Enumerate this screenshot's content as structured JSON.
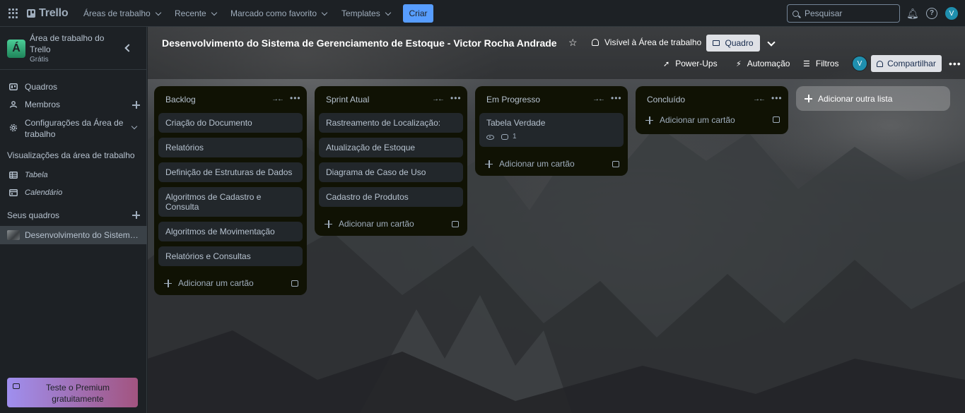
{
  "topnav": {
    "app_name": "Trello",
    "menus": [
      "Áreas de trabalho",
      "Recente",
      "Marcado como favorito",
      "Templates"
    ],
    "create_label": "Criar",
    "search_placeholder": "Pesquisar",
    "avatar_initial": "V",
    "icons": [
      "app-switcher-icon",
      "trello-logo-icon",
      "search-icon",
      "notifications-icon",
      "help-icon"
    ]
  },
  "sidebar": {
    "workspace_initial": "Á",
    "workspace_name": "Área de trabalho do Trello",
    "workspace_plan": "Grátis",
    "items": [
      {
        "label": "Quadros",
        "icon": "board-icon"
      },
      {
        "label": "Membros",
        "icon": "members-icon"
      },
      {
        "label": "Configurações da Área de trabalho",
        "icon": "gear-icon"
      }
    ],
    "views_heading": "Visualizações da área de trabalho",
    "views": [
      {
        "label": "Tabela",
        "icon": "table-icon"
      },
      {
        "label": "Calendário",
        "icon": "calendar-icon"
      }
    ],
    "boards_heading": "Seus quadros",
    "boards": [
      {
        "label": "Desenvolvimento do Sistema de Gerenciamento de Estoque - Victor Rocha Andrade"
      }
    ],
    "premium_label": "Teste o Premium gratuitamente"
  },
  "board": {
    "title": "Desenvolvimento do Sistema de Gerenciamento de Estoque - Victor Rocha Andrade",
    "visibility": "Visível à Área de trabalho",
    "view_label": "Quadro",
    "powerups_label": "Power-Ups",
    "automation_label": "Automação",
    "filters_label": "Filtros",
    "member_initial": "V",
    "share_label": "Compartilhar",
    "add_list_label": "Adicionar outra lista",
    "add_card_label": "Adicionar um cartão",
    "lists": [
      {
        "title": "Backlog",
        "cards": [
          "Criação do Documento",
          "Relatórios",
          "Definição de Estruturas de Dados",
          "Algoritmos de Cadastro e Consulta",
          "Algoritmos de Movimentação",
          "Relatórios e Consultas"
        ]
      },
      {
        "title": "Sprint Atual",
        "cards": [
          "Rastreamento de Localização:",
          "Atualização de Estoque",
          "Diagrama de Caso de Uso",
          "Cadastro de Produtos"
        ]
      },
      {
        "title": "Em Progresso",
        "cards": [
          "Tabela Verdade"
        ],
        "card_comment_count": "1"
      },
      {
        "title": "Concluído",
        "cards": []
      }
    ]
  }
}
